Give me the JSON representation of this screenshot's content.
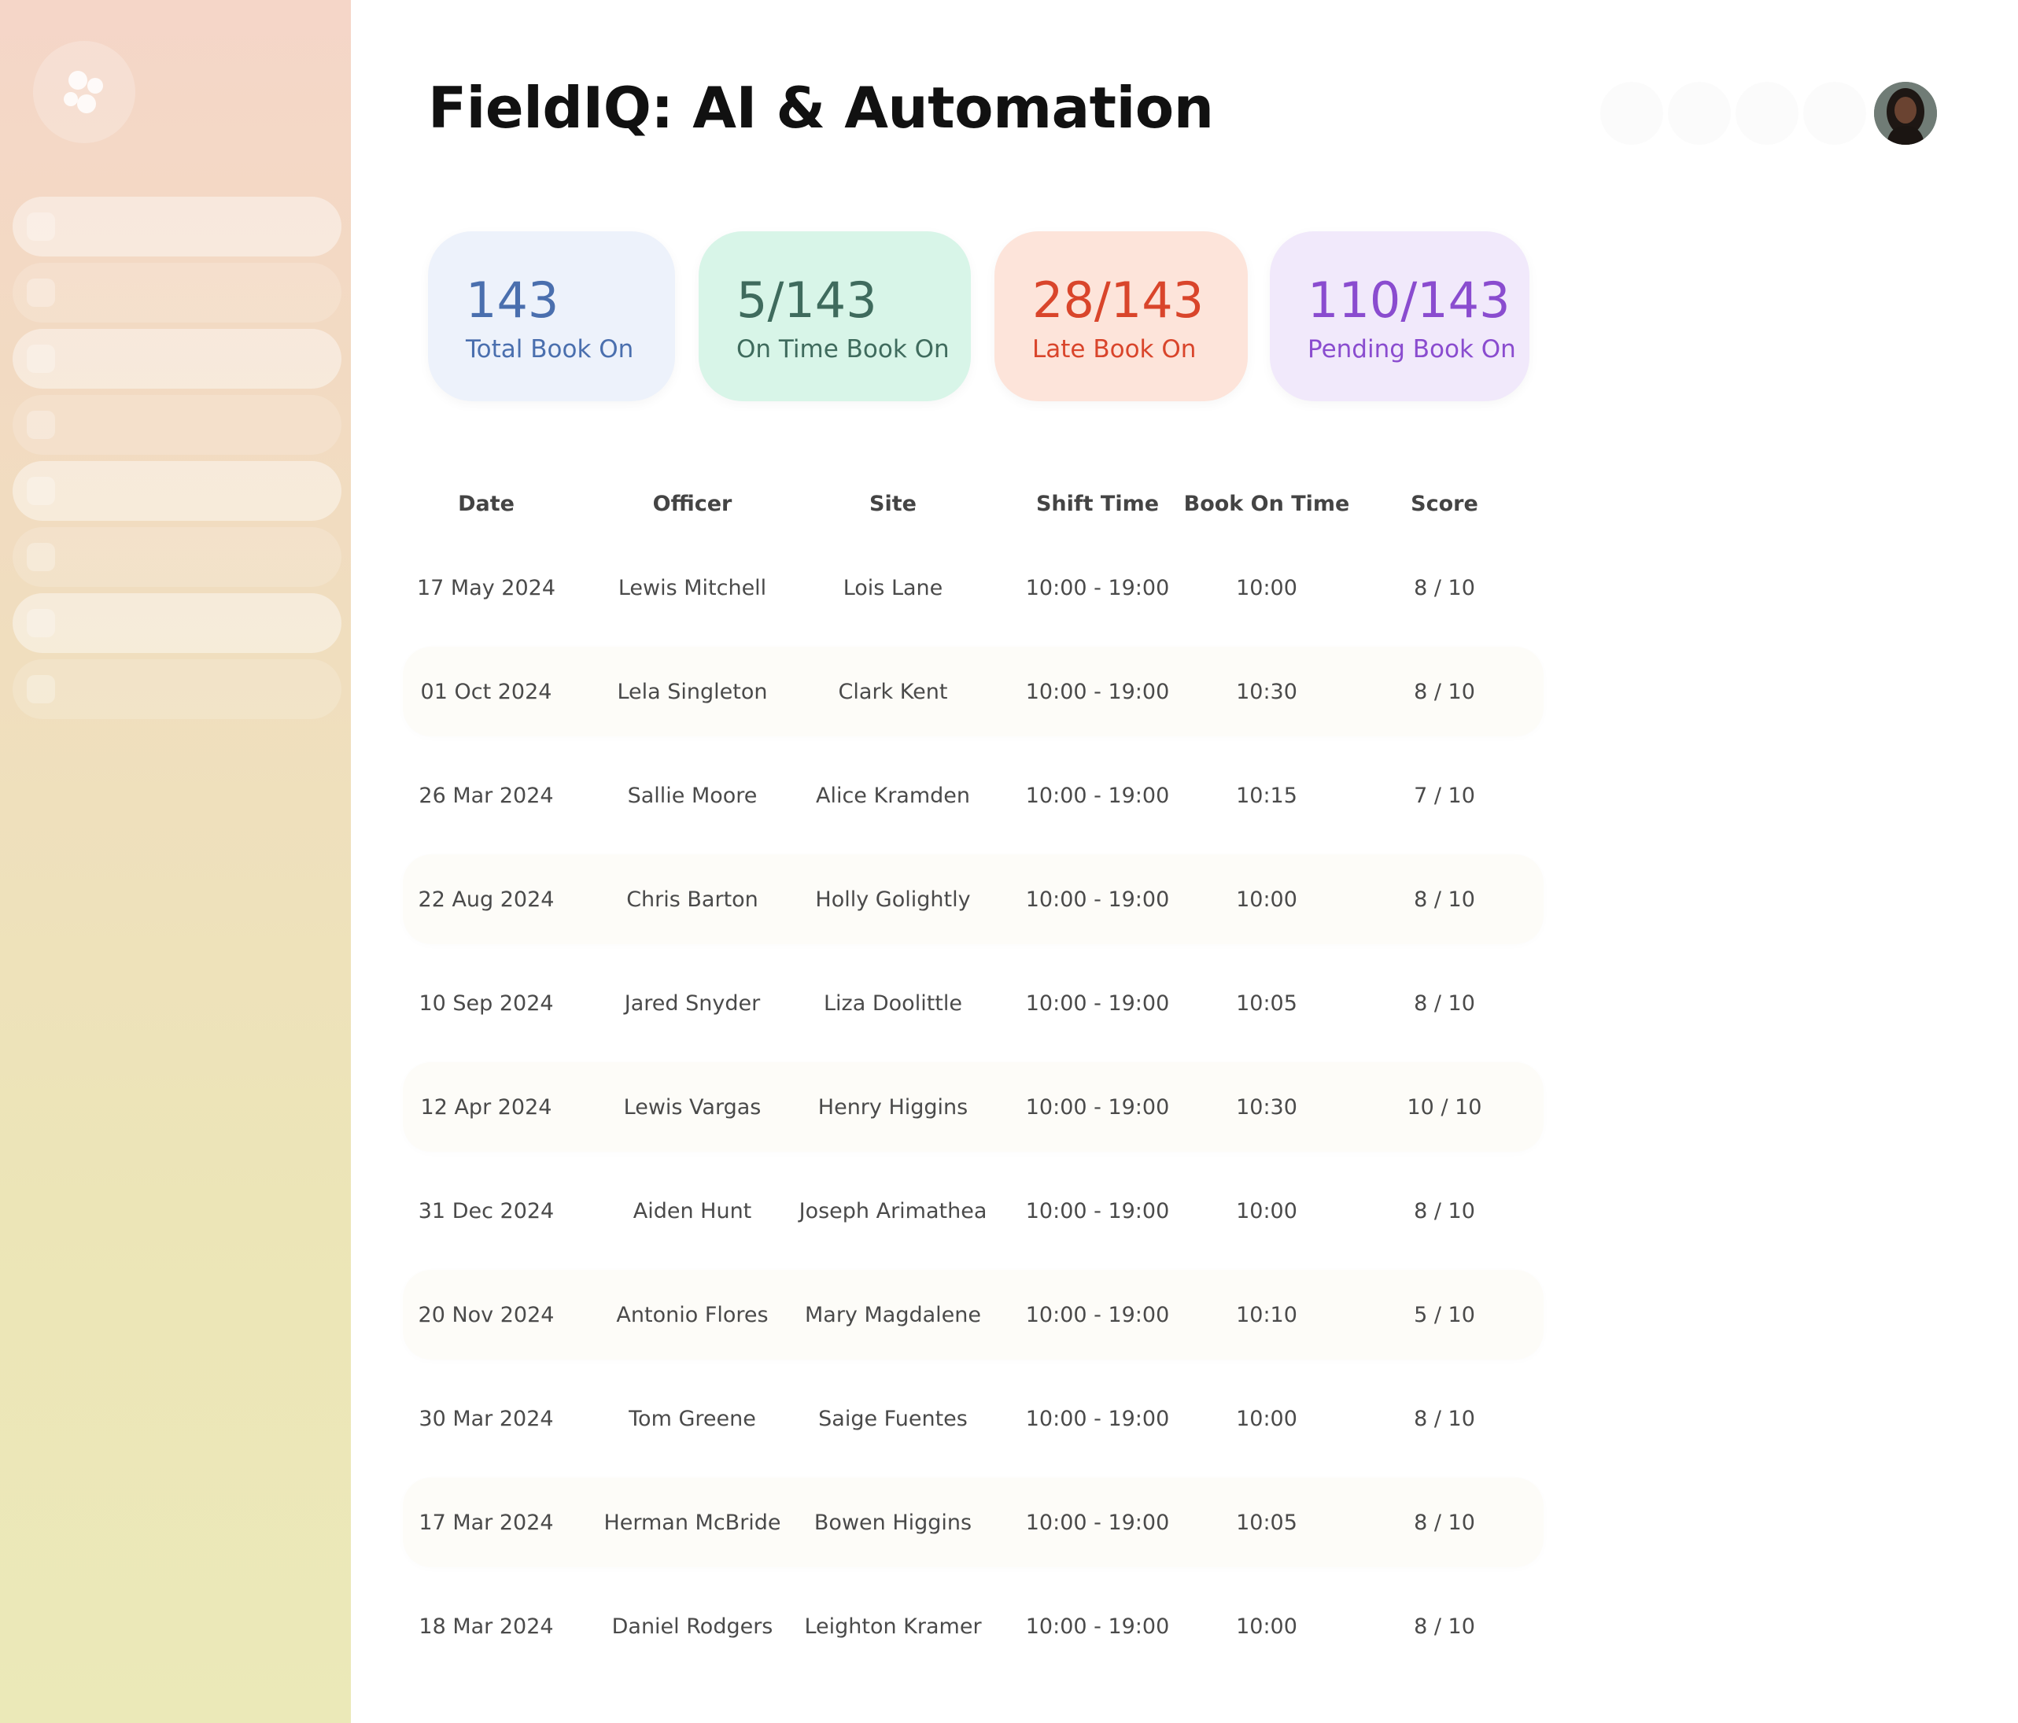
{
  "page": {
    "title": "FieldIQ: AI & Automation"
  },
  "colors": {
    "sidebar_top": "#f5d6c8",
    "sidebar_bottom": "#ebe9b8",
    "total_bg": "#edf2fb",
    "total_fg": "#4a6fae",
    "ontime_bg": "#d8f5e8",
    "ontime_fg": "#3f6b5d",
    "late_bg": "#fde4da",
    "late_fg": "#d9452b",
    "pending_bg": "#f1e9fb",
    "pending_fg": "#8a4ccf"
  },
  "sidebar": {
    "logo_icon": "app-logo-icon",
    "nav_count": 8,
    "active_items": [
      0,
      2,
      4,
      6
    ]
  },
  "stats": [
    {
      "value": "143",
      "label": "Total Book On"
    },
    {
      "value": "5/143",
      "label": "On Time Book On"
    },
    {
      "value": "28/143",
      "label": "Late Book On"
    },
    {
      "value": "110/143",
      "label": "Pending Book On"
    }
  ],
  "table": {
    "columns": [
      "Date",
      "Officer",
      "Site",
      "Shift Time",
      "Book On Time",
      "Score"
    ],
    "rows": [
      [
        "17 May 2024",
        "Lewis Mitchell",
        "Lois Lane",
        "10:00 - 19:00",
        "10:00",
        "8 / 10"
      ],
      [
        "01 Oct 2024",
        "Lela Singleton",
        "Clark Kent",
        "10:00 - 19:00",
        "10:30",
        "8 / 10"
      ],
      [
        "26 Mar 2024",
        "Sallie Moore",
        "Alice Kramden",
        "10:00 - 19:00",
        "10:15",
        "7 / 10"
      ],
      [
        "22 Aug 2024",
        "Chris Barton",
        "Holly Golightly",
        "10:00 - 19:00",
        "10:00",
        "8 / 10"
      ],
      [
        "10 Sep 2024",
        "Jared Snyder",
        "Liza Doolittle",
        "10:00 - 19:00",
        "10:05",
        "8 / 10"
      ],
      [
        "12 Apr 2024",
        "Lewis Vargas",
        "Henry Higgins",
        "10:00 - 19:00",
        "10:30",
        "10 / 10"
      ],
      [
        "31 Dec 2024",
        "Aiden Hunt",
        "Joseph Arimathea",
        "10:00 - 19:00",
        "10:00",
        "8 / 10"
      ],
      [
        "20 Nov 2024",
        "Antonio Flores",
        "Mary Magdalene",
        "10:00 - 19:00",
        "10:10",
        "5 / 10"
      ],
      [
        "30 Mar 2024",
        "Tom Greene",
        "Saige Fuentes",
        "10:00 - 19:00",
        "10:00",
        "8 / 10"
      ],
      [
        "17 Mar 2024",
        "Herman McBride",
        "Bowen Higgins",
        "10:00 - 19:00",
        "10:05",
        "8 / 10"
      ],
      [
        "18 Mar 2024",
        "Daniel Rodgers",
        "Leighton Kramer",
        "10:00 - 19:00",
        "10:00",
        "8 / 10"
      ]
    ]
  }
}
